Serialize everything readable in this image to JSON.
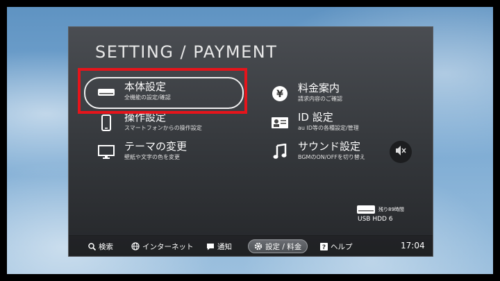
{
  "panel": {
    "title": "SETTING / PAYMENT"
  },
  "menu": {
    "console": {
      "title": "本体設定",
      "subtitle": "全機能の設定/確認"
    },
    "remote": {
      "title": "操作設定",
      "subtitle": "スマートフォンからの操作設定"
    },
    "theme": {
      "title": "テーマの変更",
      "subtitle": "壁紙や文字の色を変更"
    },
    "billing": {
      "title": "料金案内",
      "subtitle": "請求内容のご確認"
    },
    "id": {
      "title": "ID 設定",
      "subtitle": "au ID等の各種設定/管理"
    },
    "sound": {
      "title": "サウンド設定",
      "subtitle": "BGMのON/OFFを切り替え"
    }
  },
  "storage": {
    "remaining": "残り89時間",
    "label": "USB HDD 6"
  },
  "bottom_bar": {
    "search": "検索",
    "internet": "インターネット",
    "notifications": "通知",
    "settings": "設定 / 料金",
    "help": "ヘルプ"
  },
  "clock": "17:04",
  "colors": {
    "highlight": "#e6141b",
    "panel": "#3a3d41"
  },
  "icons": [
    "device-icon",
    "smartphone-icon",
    "monitor-icon",
    "yen-icon",
    "id-card-icon",
    "music-note-icon",
    "mute-icon",
    "hdd-icon",
    "search-icon",
    "globe-icon",
    "chat-icon",
    "gear-icon",
    "help-icon"
  ]
}
